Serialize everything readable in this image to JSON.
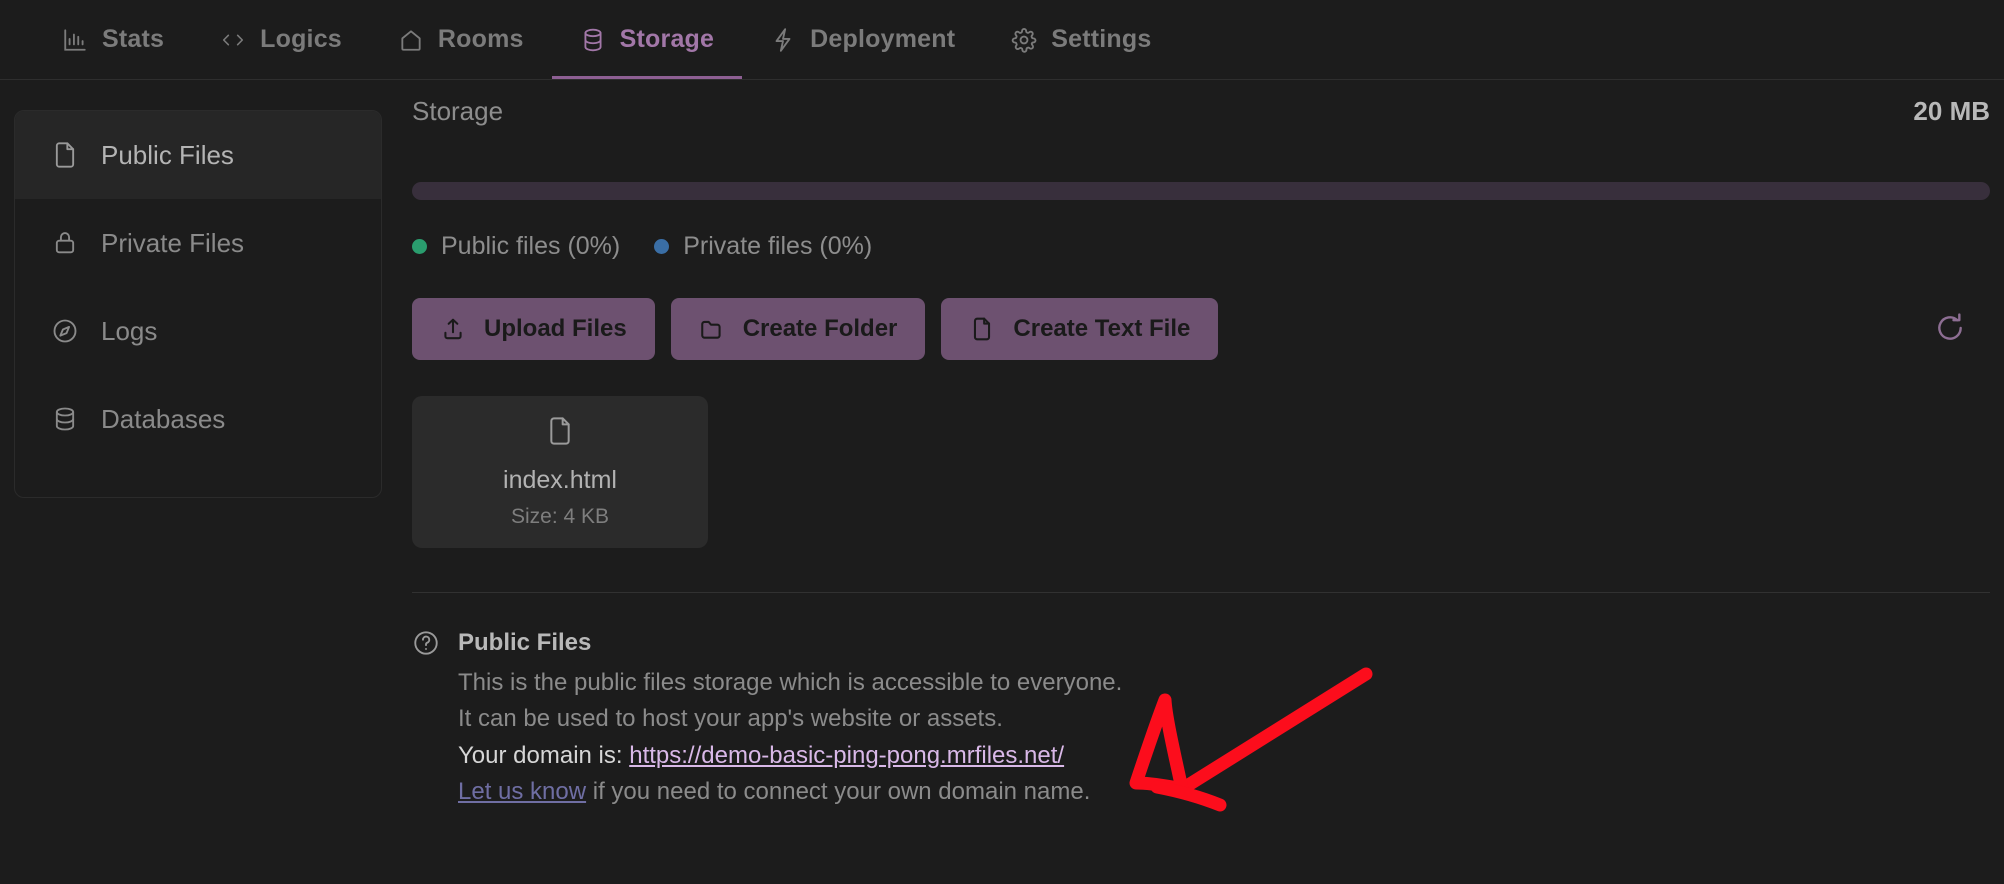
{
  "topnav": {
    "tabs": [
      {
        "label": "Stats",
        "icon": "bar-chart-icon",
        "active": false
      },
      {
        "label": "Logics",
        "icon": "code-icon",
        "active": false
      },
      {
        "label": "Rooms",
        "icon": "home-icon",
        "active": false
      },
      {
        "label": "Storage",
        "icon": "database-icon",
        "active": true
      },
      {
        "label": "Deployment",
        "icon": "lightning-icon",
        "active": false
      },
      {
        "label": "Settings",
        "icon": "gear-icon",
        "active": false
      }
    ],
    "active_color": "#a277a8",
    "inactive_color": "#7b7b7b"
  },
  "sidebar": {
    "items": [
      {
        "label": "Public Files",
        "icon": "file-icon",
        "active": true
      },
      {
        "label": "Private Files",
        "icon": "lock-icon",
        "active": false
      },
      {
        "label": "Logs",
        "icon": "compass-icon",
        "active": false
      },
      {
        "label": "Databases",
        "icon": "database-icon",
        "active": false
      }
    ]
  },
  "storage": {
    "title": "Storage",
    "total": "20 MB",
    "progress_percent": 0,
    "legend": [
      {
        "label": "Public files (0%)",
        "color": "#2a9d6e",
        "percent": 0
      },
      {
        "label": "Private files (0%)",
        "color": "#3a6ea5",
        "percent": 0
      }
    ]
  },
  "actions": {
    "buttons": [
      {
        "label": "Upload Files",
        "icon": "upload-icon"
      },
      {
        "label": "Create Folder",
        "icon": "folder-icon"
      },
      {
        "label": "Create Text File",
        "icon": "file-icon"
      }
    ],
    "refresh_icon": "refresh-icon",
    "button_color": "#6d5170"
  },
  "files": [
    {
      "name": "index.html",
      "size": "Size: 4 KB",
      "icon": "file-icon"
    }
  ],
  "info": {
    "icon": "question-circle-icon",
    "title": "Public Files",
    "line1": "This is the public files storage which is accessible to everyone.",
    "line2": "It can be used to host your app's website or assets.",
    "domain_prefix": "Your domain is:",
    "domain_url": "https://demo-basic-ping-pong.mrfiles.net/",
    "know_link": "Let us know",
    "know_rest": " if you need to connect your own domain name."
  },
  "annotation": {
    "type": "hand-drawn-arrow",
    "color": "#fc0d1c",
    "points_to": "domain_url"
  }
}
